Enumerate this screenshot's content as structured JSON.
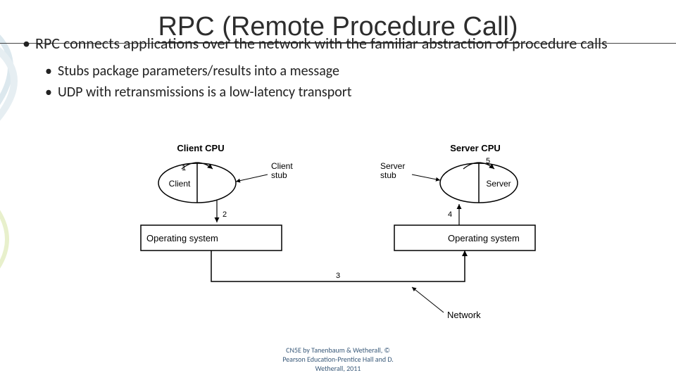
{
  "title": "RPC (Remote Procedure Call)",
  "bullets": {
    "l1": "RPC connects applications over the network with the familiar abstraction of procedure calls",
    "l2a": "Stubs package parameters/results into a message",
    "l2b": "UDP with retransmissions is a low-latency transport"
  },
  "diagram": {
    "client_cpu": "Client CPU",
    "server_cpu": "Server CPU",
    "client": "Client",
    "server": "Server",
    "client_stub": "Client\nstub",
    "server_stub": "Server\nstub",
    "os_left": "Operating system",
    "os_right": "Operating system",
    "network": "Network",
    "n1": "1",
    "n2": "2",
    "n3": "3",
    "n4": "4",
    "n5": "5"
  },
  "credit": {
    "l1": "CN5E by Tanenbaum & Wetherall, ©",
    "l2": "Pearson Education-Prentice Hall and D.",
    "l3": "Wetherall, 2011"
  }
}
